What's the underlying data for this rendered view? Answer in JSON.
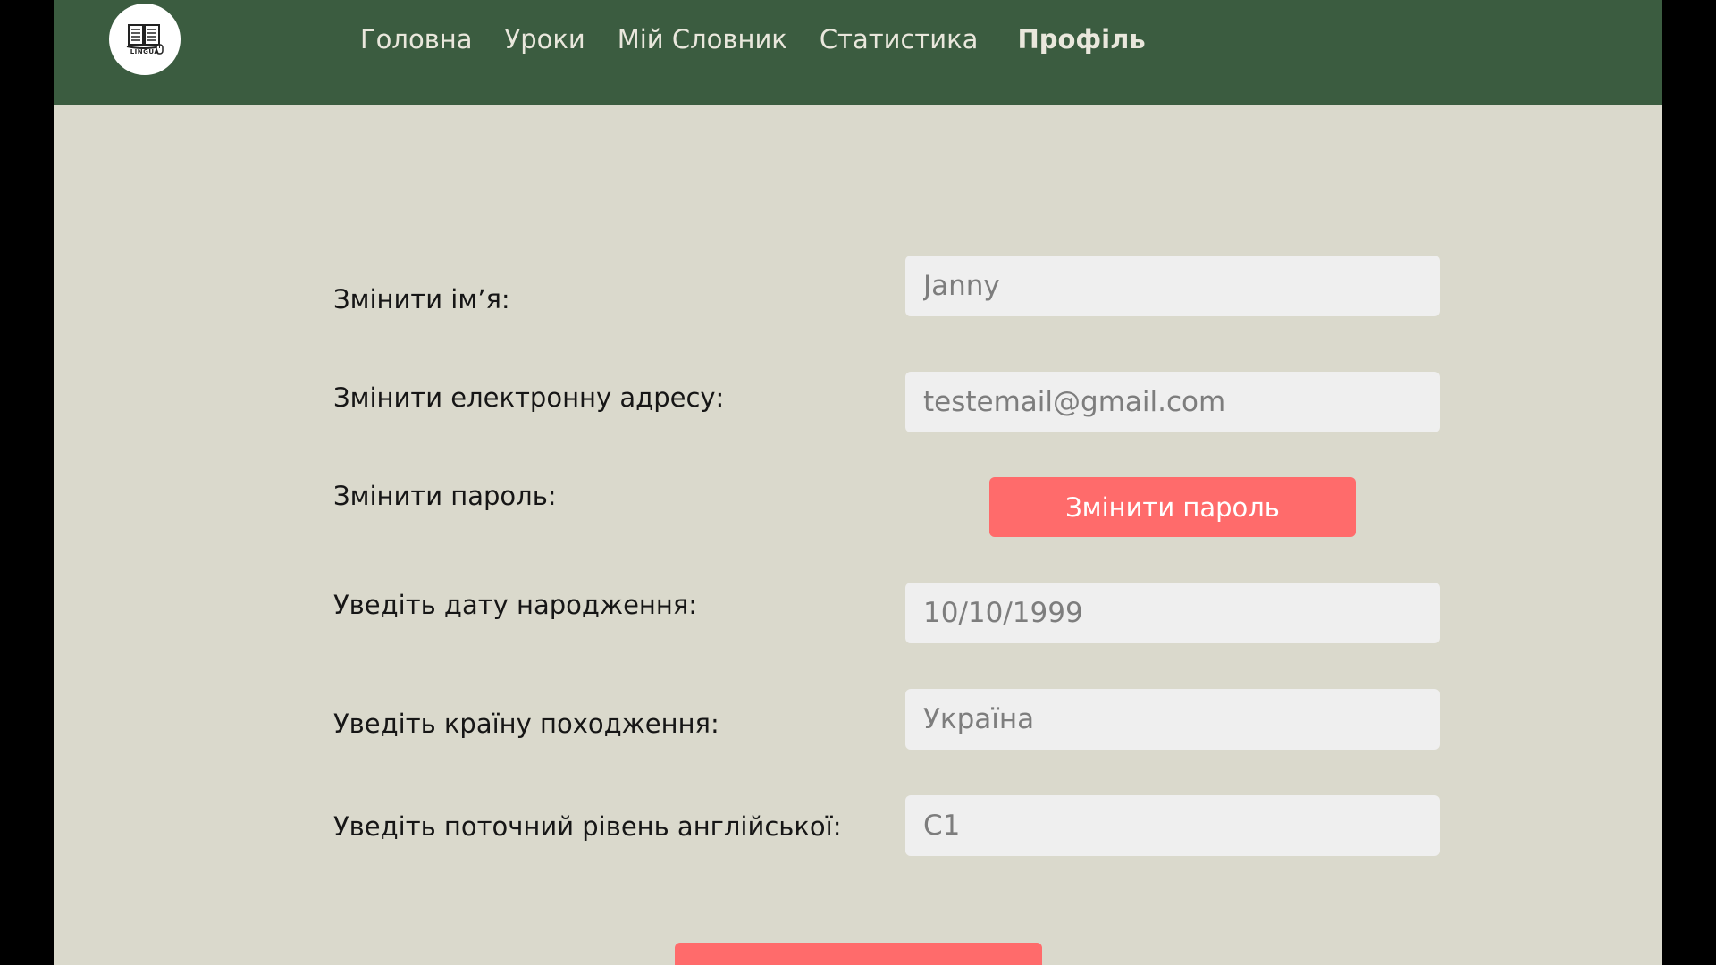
{
  "brand": {
    "logo_text": "LINGUA"
  },
  "nav": {
    "items": [
      {
        "label": "Головна"
      },
      {
        "label": "Уроки"
      },
      {
        "label": "Мій Словник"
      },
      {
        "label": "Статистика"
      },
      {
        "label": "Профіль",
        "active": true
      }
    ]
  },
  "form": {
    "name": {
      "label": "Змінити ім’я:",
      "value": "Janny"
    },
    "email": {
      "label": "Змінити електронну адресу:",
      "value": "testemail@gmail.com"
    },
    "password": {
      "label": "Змінити пароль:",
      "button_label": "Змінити пароль"
    },
    "birthdate": {
      "label": "Уведіть дату народження:",
      "value": "10/10/1999"
    },
    "country": {
      "label": "Уведіть країну походження:",
      "value": "Україна"
    },
    "level": {
      "label": "Уведіть поточний рівень англійської:",
      "value": "C1"
    }
  },
  "colors": {
    "navbar": "#3b5c40",
    "background": "#dad9cc",
    "accent": "#ff6b6b",
    "input_bg": "#efefef"
  },
  "icons": {
    "logo": "open-book-icon"
  }
}
